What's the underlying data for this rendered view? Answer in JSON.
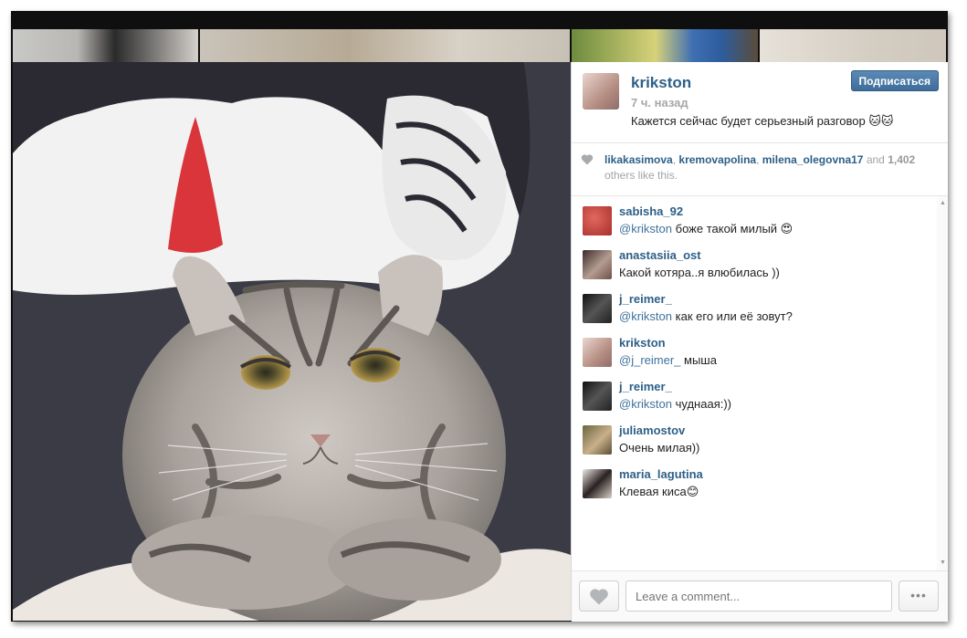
{
  "post": {
    "author": "krikston",
    "time_ago": "7 ч. назад",
    "caption": "Кажется сейчас будет серьезный разговор 🐱🐱",
    "follow_label": "Подписаться"
  },
  "likes": {
    "users": [
      "likakasimova",
      "kremovapolina",
      "milena_olegovna17"
    ],
    "and_text": "and",
    "count": "1,402",
    "suffix": "others like this."
  },
  "comments": [
    {
      "user": "sabisha_92",
      "mention": "@krikston",
      "text": "боже такой милый 😍",
      "avatar_color": "#c94a44"
    },
    {
      "user": "anastasiia_ost",
      "mention": "",
      "text": "Какой котяра..я влюбилась ))",
      "avatar_color": "#7a5a55"
    },
    {
      "user": "j_reimer_",
      "mention": "@krikston",
      "text": "как его или её зовут?",
      "avatar_color": "#2b2b2b"
    },
    {
      "user": "krikston",
      "mention": "@j_reimer_",
      "text": "мыша",
      "avatar_color": "#c9a79a"
    },
    {
      "user": "j_reimer_",
      "mention": "@krikston",
      "text": "чуднаая:))",
      "avatar_color": "#2b2b2b"
    },
    {
      "user": "juliamostov",
      "mention": "",
      "text": "Очень милая))",
      "avatar_color": "#8a7b54"
    },
    {
      "user": "maria_lagutina",
      "mention": "",
      "text": "Клевая киса😊",
      "avatar_color": "#d9cfc8"
    }
  ],
  "footer": {
    "comment_placeholder": "Leave a comment...",
    "more_label": "•••"
  },
  "colors": {
    "link": "#2d5f87",
    "follow_button": "#4a78a6"
  },
  "icons": {
    "like_icon": "heart-icon",
    "more_icon": "ellipsis-icon"
  }
}
